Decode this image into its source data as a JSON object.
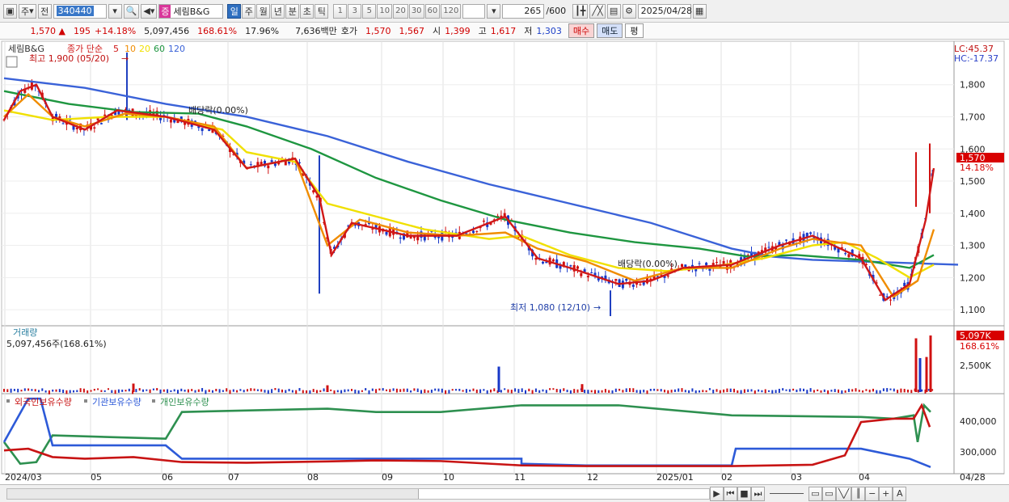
{
  "toolbar": {
    "type_label": "주",
    "prev_label": "전",
    "code": "340440",
    "market_badge": "증",
    "stock_name": "세림B&G",
    "periods": [
      "일",
      "주",
      "월",
      "년",
      "분",
      "초",
      "틱"
    ],
    "minute_options": [
      "1",
      "3",
      "5",
      "10",
      "20",
      "30",
      "60",
      "120"
    ],
    "count": "265",
    "count_max": "/600",
    "date": "2025/04/28"
  },
  "quote": {
    "price": "1,570",
    "change": "195",
    "change_pct": "+14.18%",
    "volume": "5,097,456",
    "volume_ratio": "168.61%",
    "turnover": "17.96%",
    "amount": "7,636백만",
    "bid_label": "호가",
    "bid1": "1,570",
    "bid2": "1,567",
    "open_label": "시",
    "open": "1,399",
    "high_label": "고",
    "high": "1,617",
    "low_label": "저",
    "low": "1,303",
    "buy_label": "매수",
    "sell_label": "매도",
    "eval_label": "평"
  },
  "price_panel": {
    "name": "세림B&G",
    "ma_title": "종가 단순",
    "ma_periods": [
      "5",
      "10",
      "20",
      "60",
      "120"
    ],
    "ma_colors": [
      "#d01818",
      "#f08c00",
      "#f0e000",
      "#1e9640",
      "#3a62d8"
    ],
    "high_note": "최고 1,900 (05/20)",
    "low_note": "최저 1,080 (12/10)",
    "div_note1": "배당락(0.00%)",
    "div_note2": "배당락(0.00%)",
    "lc": "LC:45.37",
    "hc": "HC:-17.37",
    "y_ticks": [
      "1,800",
      "1,700",
      "1,600",
      "1,500",
      "1,400",
      "1,300",
      "1,200",
      "1,100"
    ],
    "last_price": "1,570",
    "last_pct": "14.18%"
  },
  "volume_panel": {
    "title": "거래량",
    "value": "5,097,456주(168.61%)",
    "tick": "2,500K",
    "last": "5,097K",
    "last_pct": "168.61%"
  },
  "holding_panel": {
    "series": [
      "외국인보유수량",
      "기관보유수량",
      "개인보유수량"
    ],
    "colors": [
      "#c81414",
      "#2d5ad8",
      "#2e9050"
    ],
    "ticks": [
      "400,000",
      "300,000"
    ]
  },
  "x_axis": {
    "labels": [
      "2024/03",
      "05",
      "06",
      "07",
      "08",
      "09",
      "10",
      "11",
      "12",
      "2025/01",
      "02",
      "03",
      "04"
    ],
    "end_label": "04/28"
  },
  "chart_data": {
    "type": "line",
    "price_range": [
      1060,
      1920
    ],
    "ma120": [
      [
        0,
        1820
      ],
      [
        100,
        1790
      ],
      [
        200,
        1740
      ],
      [
        300,
        1700
      ],
      [
        400,
        1640
      ],
      [
        500,
        1560
      ],
      [
        600,
        1490
      ],
      [
        700,
        1430
      ],
      [
        800,
        1370
      ],
      [
        850,
        1330
      ],
      [
        900,
        1290
      ],
      [
        950,
        1265
      ],
      [
        1000,
        1255
      ],
      [
        1060,
        1250
      ],
      [
        1180,
        1240
      ]
    ],
    "ma60": [
      [
        0,
        1780
      ],
      [
        80,
        1740
      ],
      [
        160,
        1715
      ],
      [
        240,
        1710
      ],
      [
        300,
        1670
      ],
      [
        380,
        1600
      ],
      [
        460,
        1510
      ],
      [
        540,
        1440
      ],
      [
        620,
        1380
      ],
      [
        700,
        1340
      ],
      [
        780,
        1310
      ],
      [
        860,
        1290
      ],
      [
        920,
        1265
      ],
      [
        980,
        1270
      ],
      [
        1060,
        1255
      ],
      [
        1120,
        1230
      ],
      [
        1150,
        1270
      ]
    ],
    "ma20": [
      [
        0,
        1720
      ],
      [
        60,
        1690
      ],
      [
        130,
        1700
      ],
      [
        200,
        1700
      ],
      [
        270,
        1660
      ],
      [
        300,
        1590
      ],
      [
        360,
        1560
      ],
      [
        400,
        1430
      ],
      [
        460,
        1390
      ],
      [
        520,
        1350
      ],
      [
        600,
        1320
      ],
      [
        640,
        1330
      ],
      [
        700,
        1270
      ],
      [
        760,
        1230
      ],
      [
        820,
        1220
      ],
      [
        880,
        1235
      ],
      [
        940,
        1260
      ],
      [
        1000,
        1300
      ],
      [
        1040,
        1310
      ],
      [
        1080,
        1260
      ],
      [
        1120,
        1200
      ],
      [
        1150,
        1240
      ]
    ],
    "ma10": [
      [
        0,
        1700
      ],
      [
        30,
        1770
      ],
      [
        60,
        1700
      ],
      [
        100,
        1670
      ],
      [
        150,
        1710
      ],
      [
        200,
        1700
      ],
      [
        260,
        1670
      ],
      [
        300,
        1540
      ],
      [
        360,
        1570
      ],
      [
        400,
        1300
      ],
      [
        440,
        1380
      ],
      [
        500,
        1340
      ],
      [
        560,
        1330
      ],
      [
        620,
        1340
      ],
      [
        660,
        1290
      ],
      [
        720,
        1250
      ],
      [
        780,
        1190
      ],
      [
        840,
        1230
      ],
      [
        900,
        1230
      ],
      [
        960,
        1290
      ],
      [
        1000,
        1320
      ],
      [
        1060,
        1300
      ],
      [
        1100,
        1140
      ],
      [
        1130,
        1190
      ],
      [
        1150,
        1350
      ]
    ],
    "ma5": [
      [
        0,
        1690
      ],
      [
        20,
        1780
      ],
      [
        40,
        1800
      ],
      [
        60,
        1700
      ],
      [
        100,
        1660
      ],
      [
        140,
        1720
      ],
      [
        200,
        1700
      ],
      [
        260,
        1660
      ],
      [
        300,
        1540
      ],
      [
        360,
        1570
      ],
      [
        390,
        1450
      ],
      [
        405,
        1270
      ],
      [
        430,
        1370
      ],
      [
        500,
        1330
      ],
      [
        560,
        1330
      ],
      [
        620,
        1390
      ],
      [
        660,
        1260
      ],
      [
        700,
        1230
      ],
      [
        760,
        1180
      ],
      [
        800,
        1190
      ],
      [
        840,
        1230
      ],
      [
        900,
        1240
      ],
      [
        960,
        1300
      ],
      [
        1000,
        1330
      ],
      [
        1060,
        1260
      ],
      [
        1090,
        1130
      ],
      [
        1120,
        1180
      ],
      [
        1140,
        1380
      ],
      [
        1150,
        1540
      ]
    ],
    "volume_spikes": [
      [
        160,
        0.15
      ],
      [
        400,
        0.12
      ],
      [
        612,
        0.45
      ],
      [
        715,
        0.14
      ],
      [
        1128,
        0.95
      ],
      [
        1133,
        0.6
      ],
      [
        1141,
        0.62
      ],
      [
        1146,
        1.0
      ]
    ],
    "foreign_holding": [
      [
        0,
        305
      ],
      [
        30,
        310
      ],
      [
        60,
        285
      ],
      [
        100,
        280
      ],
      [
        160,
        285
      ],
      [
        220,
        270
      ],
      [
        300,
        268
      ],
      [
        400,
        272
      ],
      [
        460,
        275
      ],
      [
        540,
        273
      ],
      [
        640,
        260
      ],
      [
        720,
        258
      ],
      [
        800,
        258
      ],
      [
        900,
        258
      ],
      [
        1000,
        262
      ],
      [
        1040,
        290
      ],
      [
        1060,
        390
      ],
      [
        1100,
        400
      ],
      [
        1125,
        400
      ],
      [
        1135,
        440
      ],
      [
        1145,
        375
      ]
    ],
    "institution_holding": [
      [
        0,
        330
      ],
      [
        30,
        460
      ],
      [
        45,
        460
      ],
      [
        60,
        320
      ],
      [
        200,
        320
      ],
      [
        220,
        280
      ],
      [
        400,
        280
      ],
      [
        640,
        280
      ],
      [
        640,
        265
      ],
      [
        720,
        260
      ],
      [
        900,
        260
      ],
      [
        905,
        310
      ],
      [
        1060,
        310
      ],
      [
        1120,
        280
      ],
      [
        1146,
        255
      ]
    ],
    "individual_holding": [
      [
        0,
        330
      ],
      [
        20,
        265
      ],
      [
        40,
        270
      ],
      [
        60,
        350
      ],
      [
        200,
        340
      ],
      [
        220,
        420
      ],
      [
        400,
        430
      ],
      [
        460,
        420
      ],
      [
        540,
        420
      ],
      [
        640,
        440
      ],
      [
        760,
        440
      ],
      [
        900,
        410
      ],
      [
        1060,
        405
      ],
      [
        1100,
        400
      ],
      [
        1125,
        410
      ],
      [
        1130,
        330
      ],
      [
        1138,
        440
      ],
      [
        1146,
        420
      ]
    ]
  }
}
